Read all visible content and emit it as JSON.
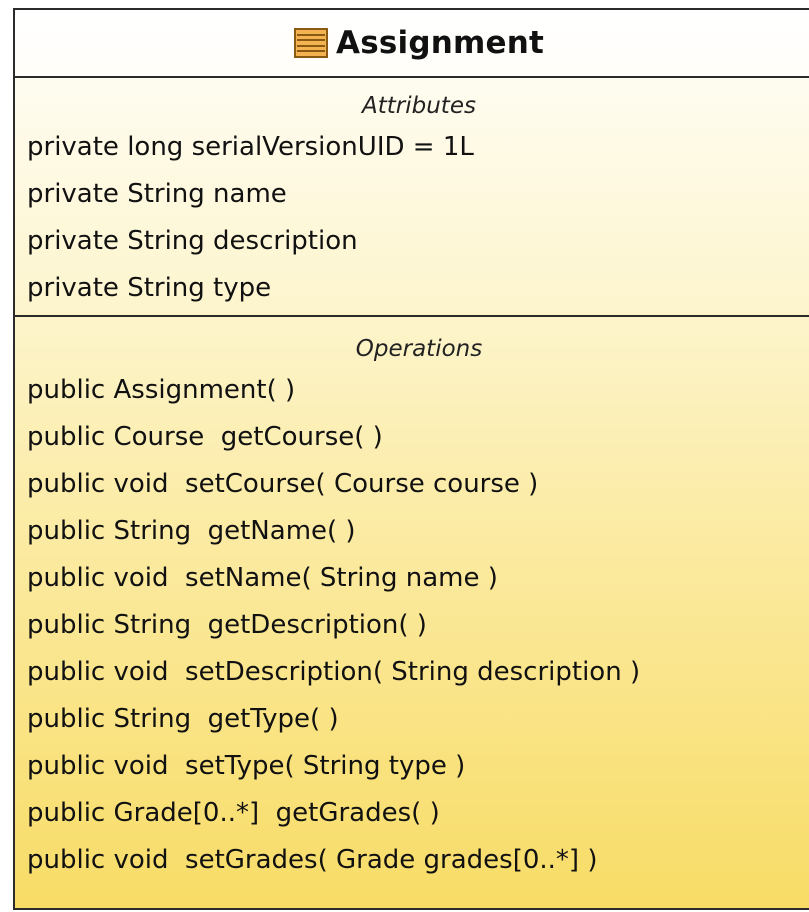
{
  "class": {
    "name": "Assignment",
    "icon": "class-icon"
  },
  "attributes": {
    "title": "Attributes",
    "items": [
      "private long serialVersionUID = 1L",
      "private String name",
      "private String description",
      "private String type"
    ]
  },
  "operations": {
    "title": "Operations",
    "items": [
      "public Assignment( )",
      "public Course  getCourse( )",
      "public void  setCourse( Course course )",
      "public String  getName( )",
      "public void  setName( String name )",
      "public String  getDescription( )",
      "public void  setDescription( String description )",
      "public String  getType( )",
      "public void  setType( String type )",
      "public Grade[0..*]  getGrades( )",
      "public void  setGrades( Grade grades[0..*] )"
    ]
  },
  "colors": {
    "border": "#2b2b2b",
    "fill_top": "#fffefa",
    "fill_bottom": "#f8dc66",
    "icon_fill": "#f2b350"
  }
}
